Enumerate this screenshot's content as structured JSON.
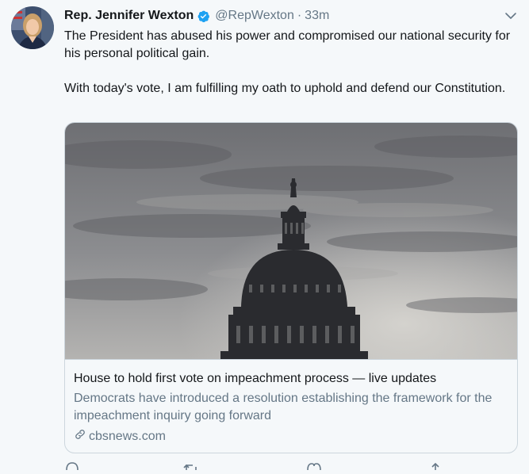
{
  "tweet": {
    "display_name": "Rep. Jennifer Wexton",
    "handle": "@RepWexton",
    "separator": "·",
    "time": "33m",
    "text_paragraph_1": "The President has abused his power and compromised our national security for his personal political gain.",
    "text_paragraph_2": "With today's vote, I am fulfilling my oath to uphold and defend our Constitution."
  },
  "card": {
    "title": "House to hold first vote on impeachment process — live updates",
    "description": "Democrats have introduced a resolution establishing the framework for the impeachment inquiry going forward",
    "domain": "cbsnews.com"
  },
  "icons": {
    "verified": "verified-badge-icon",
    "caret": "chevron-down-icon",
    "link": "link-icon",
    "reply": "reply-icon",
    "retweet": "retweet-icon",
    "like": "heart-icon",
    "share": "share-icon"
  },
  "colors": {
    "background": "#f5f8fa",
    "verified_blue": "#1da1f2",
    "secondary_text": "#657786",
    "border": "#ccd6dd"
  }
}
